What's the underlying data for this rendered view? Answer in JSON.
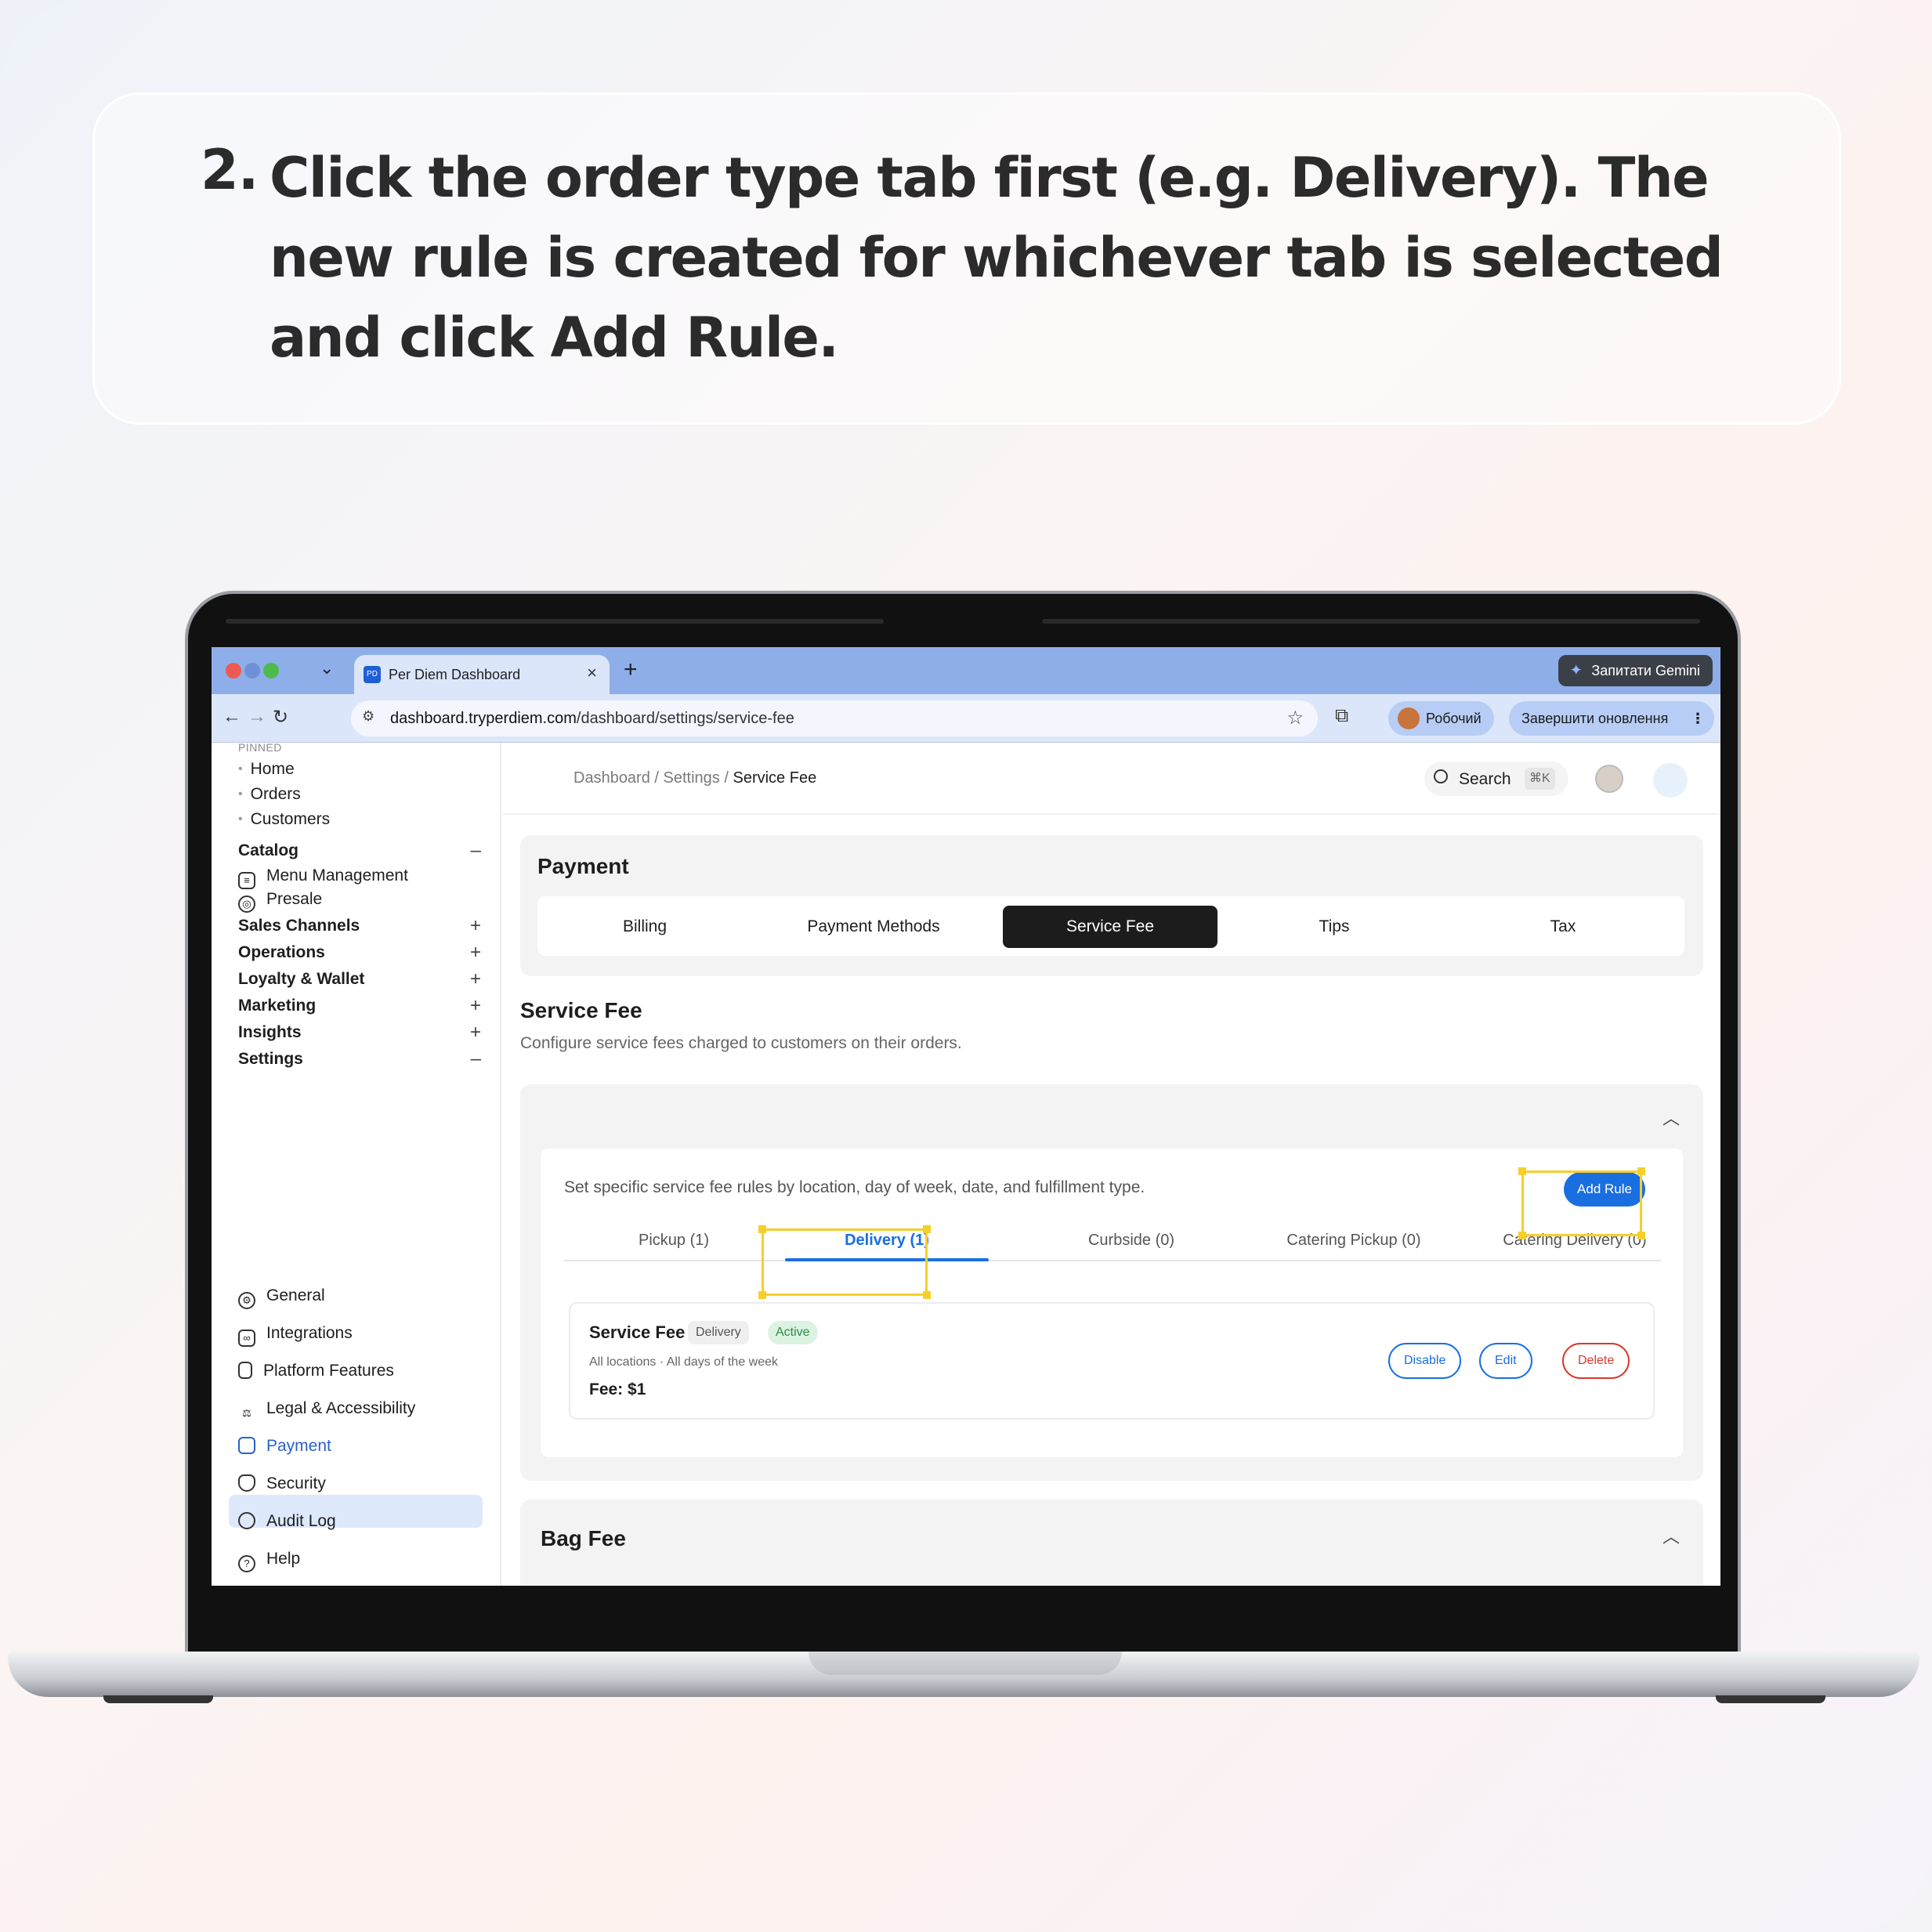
{
  "instruction": {
    "number": "2.",
    "text": "Click the order type tab first (e.g. Delivery). The new rule is created for whichever tab is selected and click Add Rule."
  },
  "browser": {
    "tab_title": "Per Diem Dashboard",
    "gemini_label": "Запитати Gemini",
    "url_host": "dashboard.tryperdiem.com",
    "url_path": "/dashboard/settings/service-fee",
    "profile_label": "Робочий",
    "update_label": "Завершити оновлення"
  },
  "sidebar": {
    "pinned_label": "PINNED",
    "pinned": [
      "Home",
      "Orders",
      "Customers"
    ],
    "catalog": {
      "label": "Catalog",
      "items": [
        "Menu Management",
        "Presale"
      ]
    },
    "sections": [
      "Sales Channels",
      "Operations",
      "Loyalty & Wallet",
      "Marketing",
      "Insights"
    ],
    "settings": {
      "label": "Settings",
      "items": [
        "General",
        "Integrations",
        "Platform Features",
        "Legal & Accessibility",
        "Payment",
        "Security",
        "Audit Log",
        "Help"
      ],
      "active": "Payment"
    }
  },
  "topbar": {
    "breadcrumb": [
      "Dashboard",
      "Settings",
      "Service Fee"
    ],
    "search_label": "Search",
    "search_shortcut": "⌘K"
  },
  "payment": {
    "title": "Payment",
    "tabs": [
      "Billing",
      "Payment Methods",
      "Service Fee",
      "Tips",
      "Tax"
    ],
    "active_tab": "Service Fee"
  },
  "service_fee": {
    "title": "Service Fee",
    "description": "Configure service fees charged to customers on their orders.",
    "rules_description": "Set specific service fee rules by location, day of week, date, and fulfillment type.",
    "add_rule_label": "Add Rule",
    "order_tabs": [
      "Pickup (1)",
      "Delivery (1)",
      "Curbside (0)",
      "Catering Pickup (0)",
      "Catering Delivery (0)"
    ],
    "active_order_tab": "Delivery (1)",
    "rule": {
      "title": "Service Fee",
      "type_badge": "Delivery",
      "status_badge": "Active",
      "scope": "All locations · All days of the week",
      "fee": "Fee: $1",
      "actions": [
        "Disable",
        "Edit",
        "Delete"
      ]
    }
  },
  "bag_fee": {
    "title": "Bag Fee"
  },
  "colors": {
    "accent_blue": "#1a6fe0",
    "highlight_yellow": "#f6cf2d",
    "delete_red": "#d9382c",
    "active_green": "#2f8a45"
  }
}
